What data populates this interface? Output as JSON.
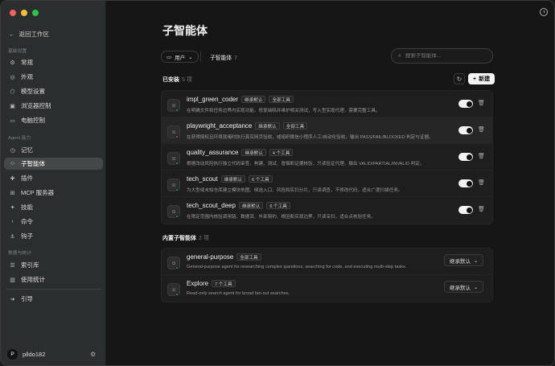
{
  "colors": {
    "traffic_close": "#ff5f57",
    "traffic_min": "#febc2e",
    "traffic_max": "#28c840",
    "status_green": "#3fa34d",
    "status_red": "#d9534f"
  },
  "sidebar": {
    "back_label": "返回工作区",
    "sections": [
      {
        "label": "基础设置",
        "items": [
          {
            "label": "常规",
            "icon": "gear-icon"
          },
          {
            "label": "外观",
            "icon": "palette-icon"
          },
          {
            "label": "模型设置",
            "icon": "cube-icon"
          },
          {
            "label": "浏览器控制",
            "icon": "browser-icon"
          },
          {
            "label": "电脑控制",
            "icon": "monitor-icon"
          }
        ]
      },
      {
        "label": "Agent 能力",
        "items": [
          {
            "label": "记忆",
            "icon": "memory-icon"
          },
          {
            "label": "子智能体",
            "icon": "bot-icon",
            "active": true
          },
          {
            "label": "插件",
            "icon": "puzzle-icon"
          },
          {
            "label": "MCP 服务器",
            "icon": "server-icon"
          },
          {
            "label": "技能",
            "icon": "skill-icon"
          },
          {
            "label": "命令",
            "icon": "terminal-icon"
          },
          {
            "label": "钩子",
            "icon": "hook-icon"
          }
        ]
      },
      {
        "label": "数据与统计",
        "items": [
          {
            "label": "索引库",
            "icon": "database-icon"
          },
          {
            "label": "使用统计",
            "icon": "chart-icon"
          }
        ]
      }
    ],
    "extra_item": {
      "label": "引导",
      "icon": "guide-icon"
    },
    "user": {
      "avatar_letter": "P",
      "name": "plldo182"
    }
  },
  "main": {
    "title": "子智能体",
    "filter": {
      "label": "用户"
    },
    "tab": {
      "label": "子智能体",
      "count": "7"
    },
    "search_placeholder": "搜索子智能体...",
    "installed": {
      "label": "已安装",
      "count": "5 项"
    },
    "new_button": "新建",
    "agents": [
      {
        "name": "impl_green_coder",
        "badges": [
          "继承默认",
          "全部工具"
        ],
        "desc": "在明确文件和任务边界内实现功能，修复缺陷并维护相关测试，写入型实现代理，需要完整工具。",
        "status": "green"
      },
      {
        "name": "playwright_acceptance",
        "badges": [
          "继承默认",
          "全部工具"
        ],
        "desc": "在获得授权且环境就绪时执行真实网页验收，或组织微信小程序人工/自动化验收，输出 PASS/FAIL/BLOCKED 判定与证据。",
        "status": "red"
      },
      {
        "name": "quality_assurance",
        "badges": [
          "继承默认",
          "4 个工具"
        ],
        "desc": "根据改动风险执行独立代码审查、构建、测试、冒烟和证据核验，只读验证代理，输出 VALID/PARTIAL/INVALID 判定。",
        "status": "green"
      },
      {
        "name": "tech_scout",
        "badges": [
          "继承默认",
          "6 个工具"
        ],
        "desc": "为大型或未知仓库建立模块地图、候选入口、风险和实扫分片，只读调查，不修改代码，适合广度扫描任务。",
        "status": "green"
      },
      {
        "name": "tech_scout_deep",
        "badges": [
          "继承默认",
          "6 个工具"
        ],
        "desc": "在限定范围内核验调用链、数据流、外部契约、根因和实现边界，只读深扫，适合点核验任务。",
        "status": "green"
      }
    ],
    "builtin": {
      "label": "内置子智能体",
      "count": "2 项"
    },
    "builtin_agents": [
      {
        "name": "general-purpose",
        "badges": [
          "全部工具"
        ],
        "desc": "General-purpose agent for researching complex questions, searching for code, and executing multi-step tasks.",
        "select": "继承默认",
        "status": "green"
      },
      {
        "name": "Explore",
        "badges": [
          "7 个工具"
        ],
        "desc": "Read-only search agent for broad fan-out searches.",
        "select": "继承默认",
        "status": "green"
      }
    ]
  }
}
